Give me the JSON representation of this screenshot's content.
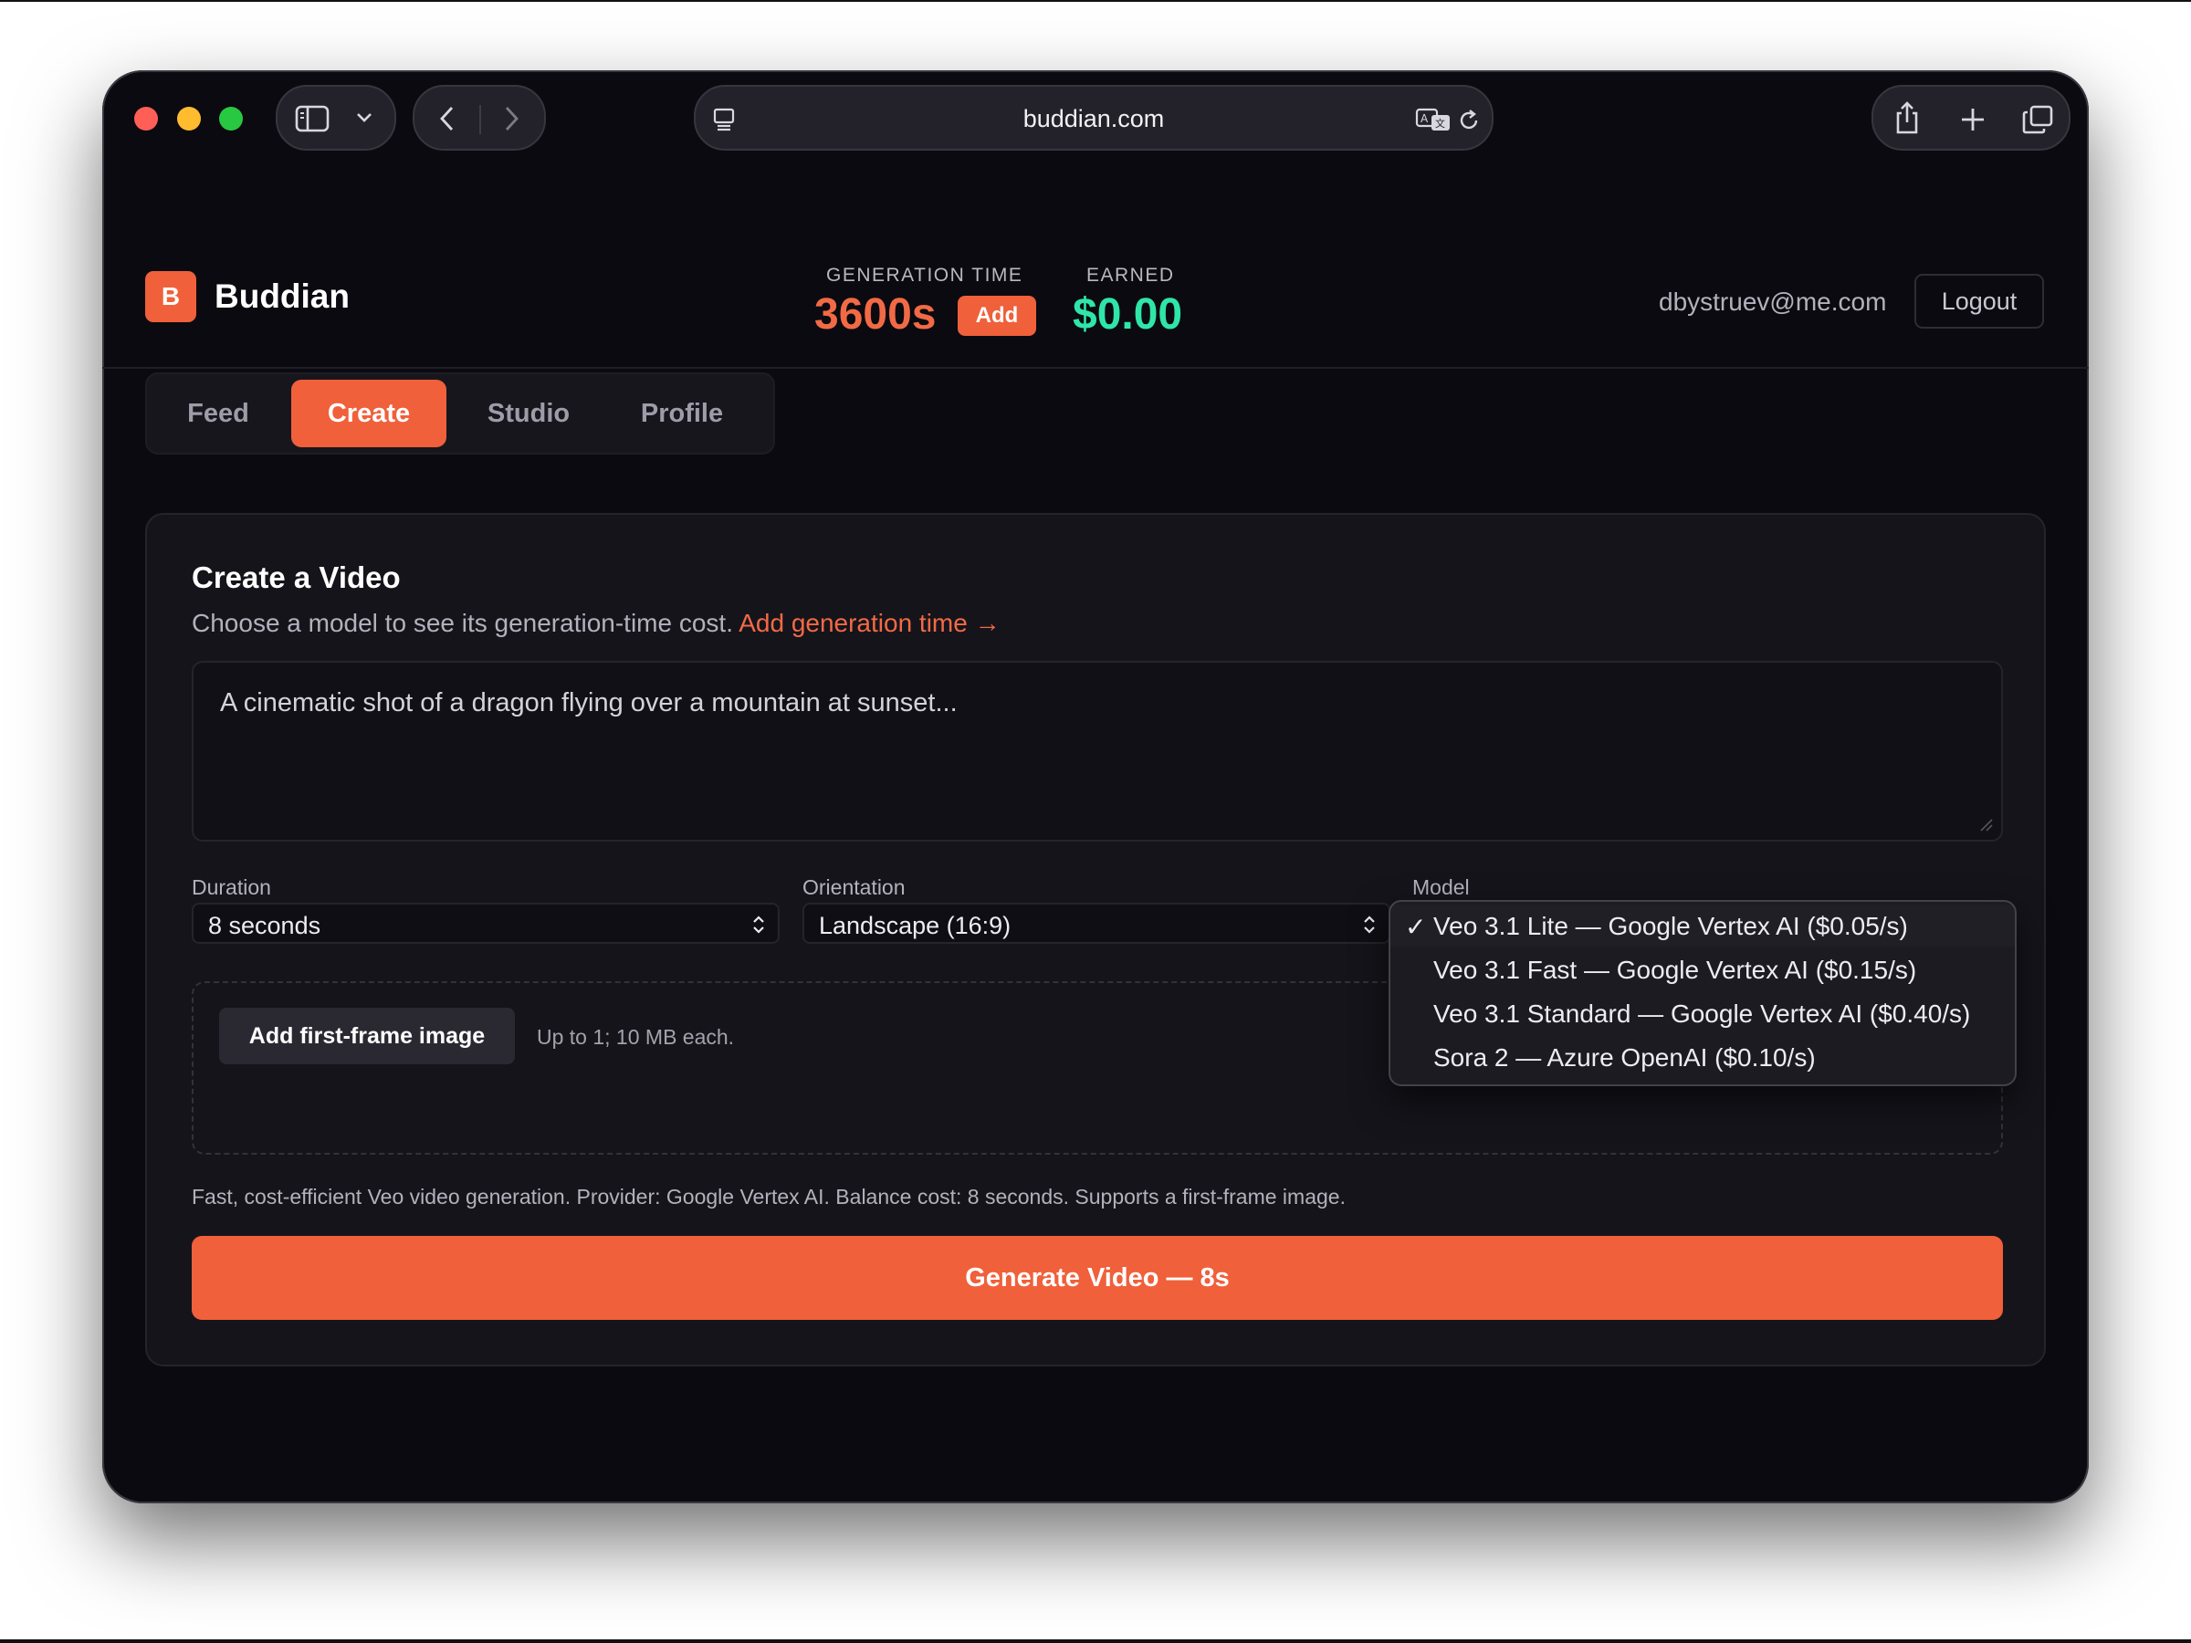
{
  "browser": {
    "url": "buddian.com"
  },
  "app": {
    "logo_letter": "B",
    "name": "Buddian",
    "generation_time_label": "GENERATION TIME",
    "generation_time_value": "3600s",
    "add_label": "Add",
    "earned_label": "EARNED",
    "earned_value": "$0.00",
    "user_email": "dbystruev@me.com",
    "logout_label": "Logout"
  },
  "tabs": [
    {
      "label": "Feed",
      "active": false
    },
    {
      "label": "Create",
      "active": true
    },
    {
      "label": "Studio",
      "active": false
    },
    {
      "label": "Profile",
      "active": false
    }
  ],
  "create": {
    "title": "Create a Video",
    "subtitle": "Choose a model to see its generation-time cost.",
    "subtitle_link": "Add generation time →",
    "prompt_placeholder": "A cinematic shot of a dragon flying over a mountain at sunset...",
    "duration_label": "Duration",
    "duration_value": "8 seconds",
    "orientation_label": "Orientation",
    "orientation_value": "Landscape (16:9)",
    "model_label": "Model",
    "first_frame_button": "Add first-frame image",
    "first_frame_note": "Up to 1; 10 MB each.",
    "model_description": "Fast, cost-efficient Veo video generation. Provider: Google Vertex AI. Balance cost: 8 seconds. Supports a first-frame image.",
    "generate_button": "Generate Video — 8s"
  },
  "model_dropdown": {
    "options": [
      {
        "label": "Veo 3.1 Lite — Google Vertex AI ($0.05/s)",
        "selected": true
      },
      {
        "label": "Veo 3.1 Fast — Google Vertex AI ($0.15/s)",
        "selected": false
      },
      {
        "label": "Veo 3.1 Standard — Google Vertex AI ($0.40/s)",
        "selected": false
      },
      {
        "label": "Sora 2 — Azure OpenAI ($0.10/s)",
        "selected": false
      }
    ],
    "check_glyph": "✓"
  },
  "colors": {
    "accent": "#f0603a",
    "earned": "#2ee6a8",
    "background": "#0b0a10"
  }
}
